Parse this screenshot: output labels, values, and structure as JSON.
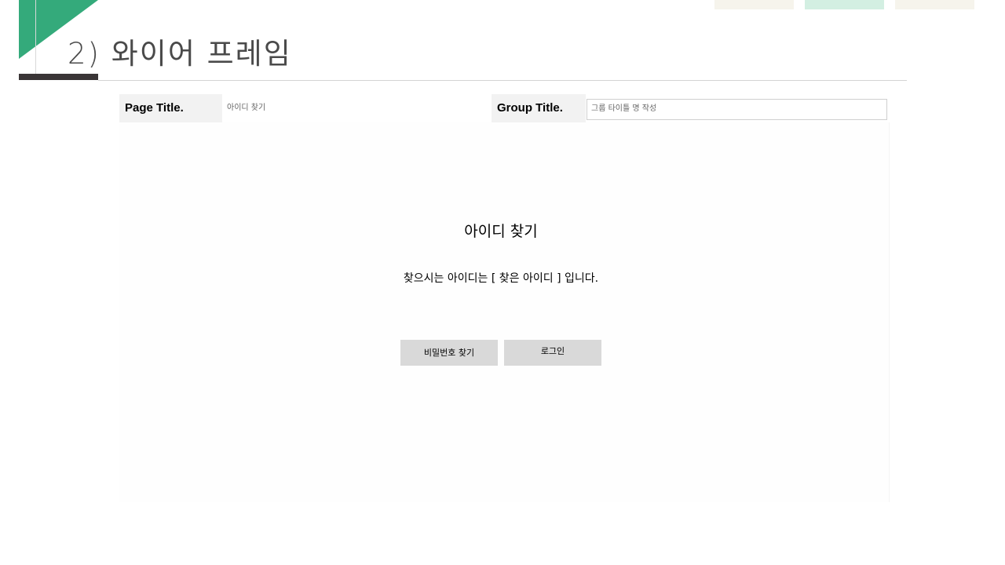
{
  "slide": {
    "title": "2) 와이어 프레임"
  },
  "colors": {
    "accent_green": "#34aa7b",
    "dark_bar": "#3a3536",
    "tab_beige": "#f6f4ec",
    "tab_mint": "#d3efe2",
    "label_bg": "#f2f2f2",
    "button_bg": "#d9d9d9"
  },
  "info_bar": {
    "page_title_label": "Page Title.",
    "page_title_value": "아이디 찾기",
    "group_title_label": "Group Title.",
    "group_title_placeholder": "그룹 타이틀 명 작성"
  },
  "wireframe": {
    "heading": "아이디 찾기",
    "message": "찾으시는 아이디는 [ 찾은 아이디 ] 입니다.",
    "buttons": {
      "find_password": "비밀번호 찾기",
      "login": "로그인"
    }
  }
}
